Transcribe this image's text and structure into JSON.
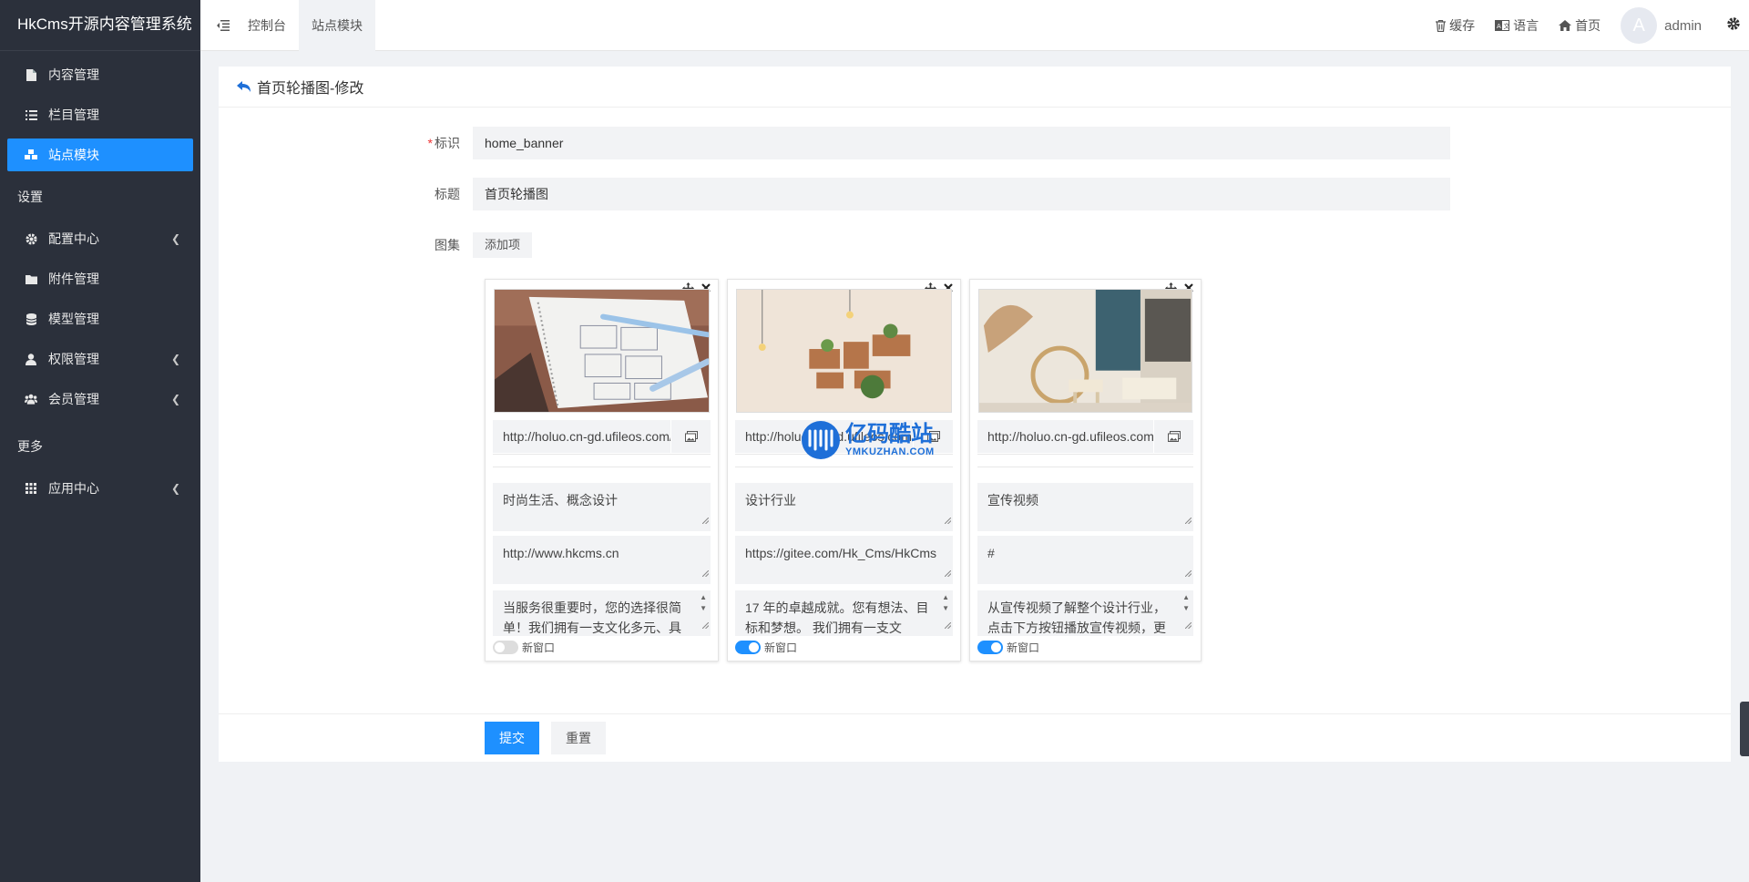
{
  "app": {
    "brand": "HkCms开源内容管理系统"
  },
  "sidebar": {
    "items": [
      {
        "label": "内容管理",
        "icon": "file-icon"
      },
      {
        "label": "栏目管理",
        "icon": "list-icon"
      },
      {
        "label": "站点模块",
        "icon": "cubes-icon",
        "active": true
      }
    ],
    "settings_label": "设置",
    "settings_items": [
      {
        "label": "配置中心",
        "icon": "gear-icon",
        "has_arrow": true
      },
      {
        "label": "附件管理",
        "icon": "folder-icon"
      },
      {
        "label": "模型管理",
        "icon": "database-icon"
      },
      {
        "label": "权限管理",
        "icon": "user-icon",
        "has_arrow": true
      },
      {
        "label": "会员管理",
        "icon": "users-icon",
        "has_arrow": true
      }
    ],
    "more_label": "更多",
    "more_items": [
      {
        "label": "应用中心",
        "icon": "grid-icon",
        "has_arrow": true
      }
    ]
  },
  "topbar": {
    "tabs": [
      "控制台",
      "站点模块"
    ],
    "right_links": {
      "cache": "缓存",
      "language": "语言",
      "home": "首页"
    },
    "avatar_letter": "A",
    "username": "admin"
  },
  "page": {
    "title": "首页轮播图-修改",
    "form": {
      "id_label": "标识",
      "id_value": "home_banner",
      "title_label": "标题",
      "title_value": "首页轮播图",
      "gallery_label": "图集",
      "add_item_label": "添加项"
    },
    "cards": [
      {
        "url": "http://holuo.cn-gd.ufileos.com/",
        "title": "时尚生活、概念设计",
        "link": "http://www.hkcms.cn",
        "desc": "当服务很重要时，您的选择很简单！我们拥有一支文化多元、具",
        "new_window": false,
        "new_window_label": "新窗口"
      },
      {
        "url": "http://holuo.cn-gd.ufileos.com/",
        "title": "设计行业",
        "link": "https://gitee.com/Hk_Cms/HkCms",
        "desc": "17 年的卓越成就。您有想法、目标和梦想。 我们拥有一支文",
        "new_window": true,
        "new_window_label": "新窗口"
      },
      {
        "url": "http://holuo.cn-gd.ufileos.com/",
        "title": "宣传视频",
        "link": "#",
        "desc": "从宣传视频了解整个设计行业，点击下方按钮播放宣传视频，更",
        "new_window": true,
        "new_window_label": "新窗口"
      }
    ],
    "submit_label": "提交",
    "reset_label": "重置"
  },
  "watermark": {
    "name": "亿码酷站",
    "sub": "YMKUZHAN.COM"
  },
  "colors": {
    "sidebar_bg": "#2b303b",
    "accent": "#1e90ff"
  }
}
